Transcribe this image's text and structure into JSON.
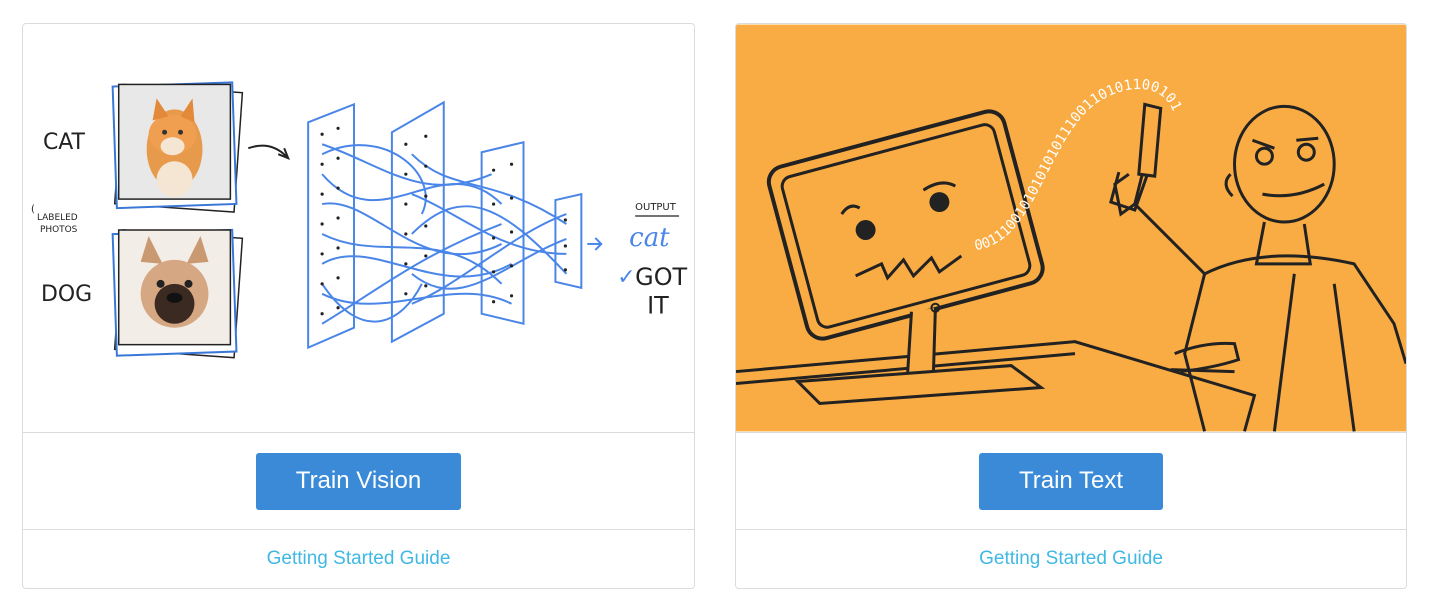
{
  "cards": [
    {
      "id": "vision",
      "button_label": "Train Vision",
      "guide_label": "Getting Started Guide",
      "illustration": {
        "label_cat": "CAT",
        "label_labeled_1": "LABELED",
        "label_labeled_2": "PHOTOS",
        "label_dog": "DOG",
        "label_output": "OUTPUT",
        "label_result": "cat",
        "label_got": "GOT",
        "label_it": "IT"
      }
    },
    {
      "id": "text",
      "button_label": "Train Text",
      "guide_label": "Getting Started Guide",
      "illustration": {
        "binary_text": "0011100101010101011100110101100101"
      }
    }
  ],
  "colors": {
    "accent": "#3a8ad8",
    "link": "#3fb8e4",
    "orange_bg": "#f9ac43",
    "network_blue": "#4a86e8"
  }
}
